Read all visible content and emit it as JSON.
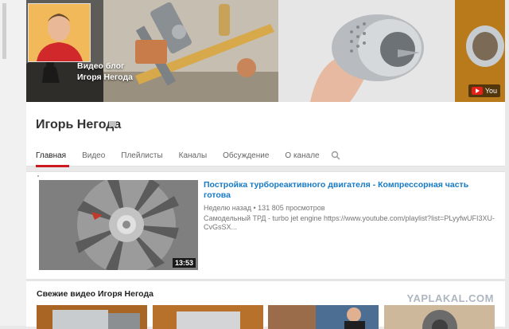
{
  "banner": {
    "text_line1": "Видео блог",
    "text_line2": "Игоря Негода",
    "link_label": "You"
  },
  "channel": {
    "name": "Игорь Негода"
  },
  "tabs": [
    {
      "label": "Главная",
      "active": true
    },
    {
      "label": "Видео"
    },
    {
      "label": "Плейлисты"
    },
    {
      "label": "Каналы"
    },
    {
      "label": "Обсуждение"
    },
    {
      "label": "О канале"
    }
  ],
  "featured": {
    "title": "Постройка турбореактивного двигателя - Компрессорная часть готова",
    "meta": "Неделю назад • 131 805 просмотров",
    "description_line1": "Самодельный ТРД - turbo jet engine https://www.youtube.com/playlist?list=PLyyfwUFI3XU-",
    "description_line2": "CvGsSX...",
    "duration": "13:53"
  },
  "fresh": {
    "title": "Свежие видео Игоря Негода"
  },
  "watermark": "YAPLAKAL.COM",
  "colors": {
    "link_blue": "#167ac6",
    "active_tab_red": "#cc181e",
    "yt_red": "#e62117"
  }
}
